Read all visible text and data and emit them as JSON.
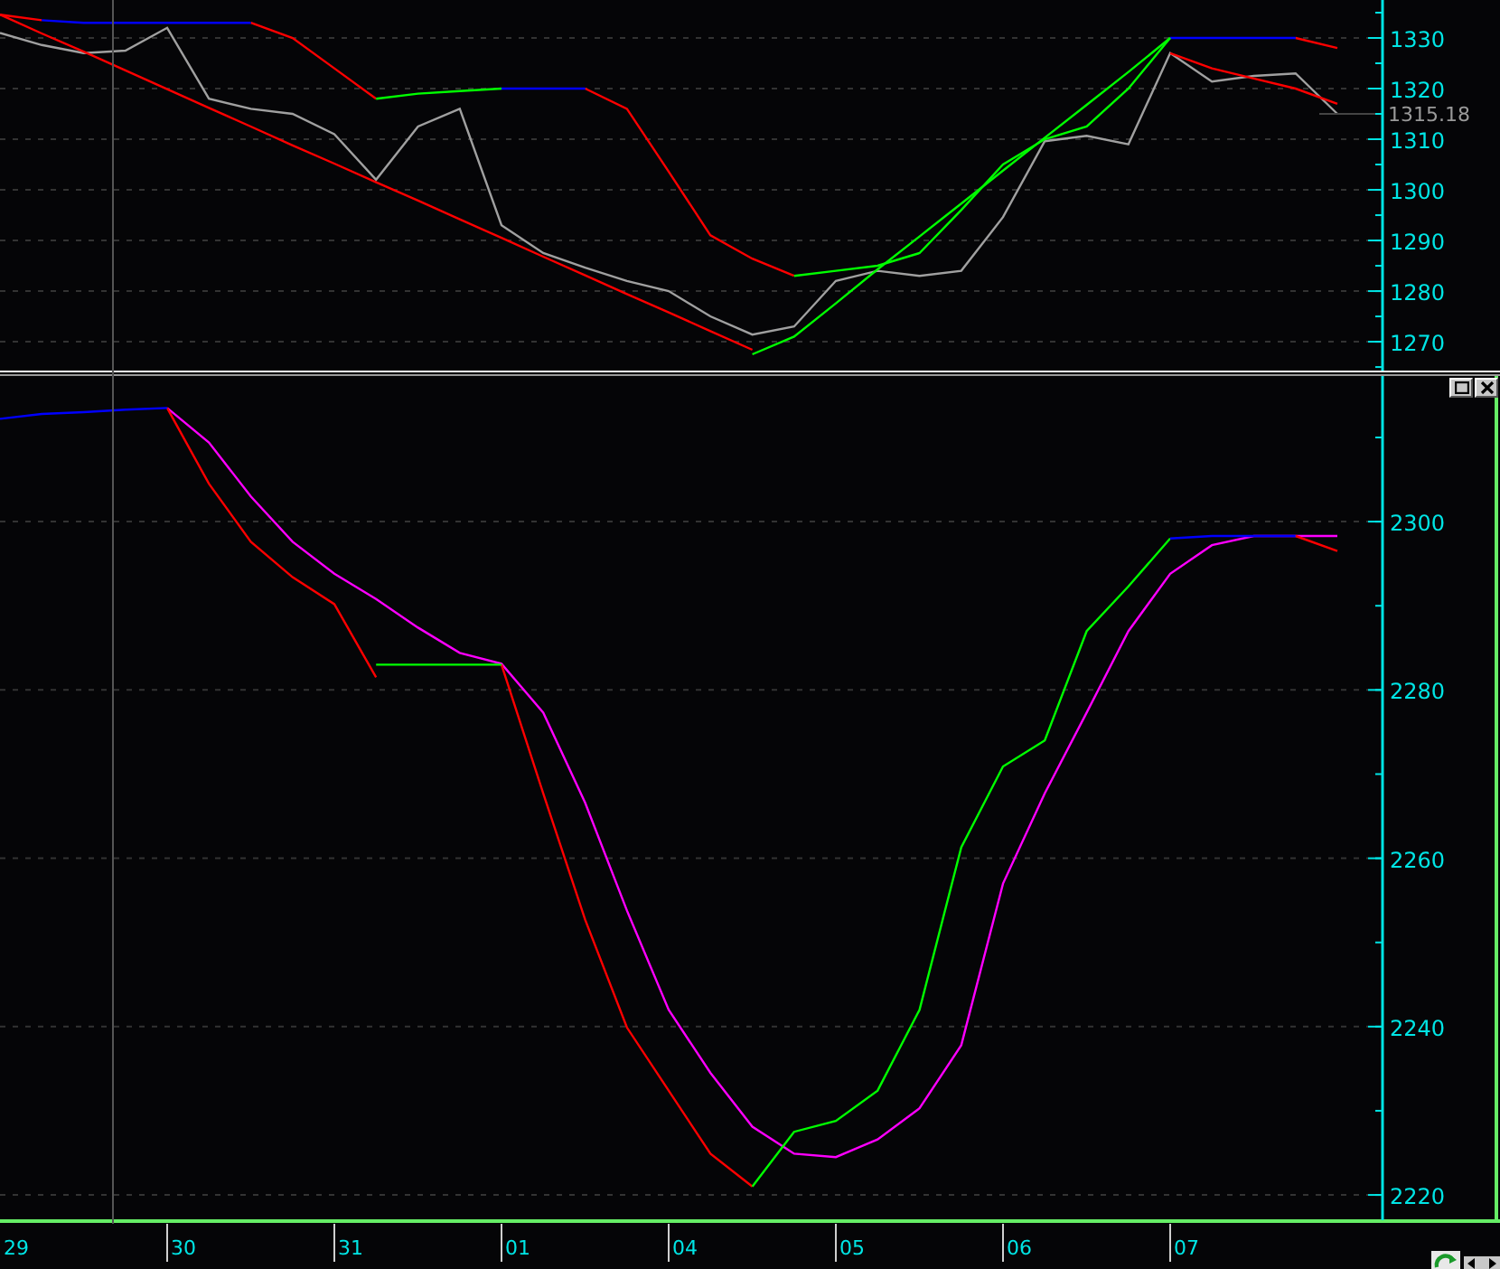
{
  "charts": [
    {
      "chart_data": {
        "type": "line",
        "grid": true,
        "categories": [
          null,
          null,
          null,
          null,
          null,
          null,
          null,
          null,
          null,
          null,
          null,
          null,
          null,
          null,
          null,
          null,
          null,
          null,
          null,
          null,
          null,
          null,
          null,
          null,
          null,
          null,
          null,
          null,
          null,
          null,
          null,
          null,
          null
        ],
        "ylim": [
          1264.3,
          1337.5
        ],
        "yticks": [
          1270,
          1280,
          1290,
          1300,
          1310,
          1320,
          1330
        ],
        "series": [
          {
            "color": "#a0a0a0",
            "values": [
              1331,
              1328.6,
              1327,
              1327.5,
              1332,
              1318,
              1316,
              1315,
              1311,
              1302,
              1312.5,
              1316,
              1293,
              1287.5,
              1284.6,
              1282,
              1280,
              1275,
              1271.4,
              1273,
              1282,
              1284,
              1283,
              1284,
              1294.6,
              1309.6,
              1310.7,
              1309,
              1327,
              1321.4,
              1322.5,
              1323,
              1315
            ]
          },
          {
            "color": "#ff0000",
            "values": [
              1334.6,
              1333.5,
              null,
              null,
              null,
              null,
              1333,
              1330,
              1324,
              1318,
              null,
              null,
              null,
              null,
              1320,
              1316,
              1303.6,
              1291,
              1286.4,
              1283,
              null,
              null,
              null,
              null,
              null,
              null,
              null,
              null,
              null,
              null,
              null,
              1330,
              1328
            ]
          },
          {
            "color": "#0000ff",
            "values": [
              null,
              1333.5,
              1333,
              1333,
              1333,
              1333,
              1333,
              null,
              null,
              null,
              null,
              null,
              1320,
              1320,
              1320,
              null,
              null,
              null,
              null,
              null,
              null,
              null,
              null,
              null,
              null,
              null,
              null,
              null,
              1330,
              1330,
              1330,
              1330,
              null
            ]
          },
          {
            "color": "#00ff00",
            "values": [
              null,
              null,
              null,
              null,
              null,
              null,
              null,
              null,
              null,
              1318,
              1319,
              1319.5,
              1320,
              null,
              null,
              null,
              null,
              null,
              null,
              1283,
              1284,
              1285,
              1287.5,
              1296,
              1305,
              1310,
              1312.5,
              1320,
              1330,
              null,
              null,
              null,
              null
            ]
          },
          {
            "color": "#ff0000",
            "values": [
              1334.6,
              1330.9,
              1327.3,
              1323.6,
              1319.9,
              1316.2,
              1312.5,
              1308.8,
              1305.2,
              1301.5,
              1297.9,
              1294.2,
              1290.5,
              1286.8,
              1283.1,
              1279.4,
              1275.8,
              1272.1,
              1268.4,
              null,
              null,
              null,
              null,
              null,
              null,
              null,
              null,
              null,
              1327,
              1324,
              1322,
              1320,
              1317
            ]
          },
          {
            "color": "#00ff00",
            "values": [
              null,
              null,
              null,
              null,
              null,
              null,
              null,
              null,
              null,
              null,
              null,
              null,
              null,
              null,
              null,
              null,
              null,
              null,
              1267.5,
              1271,
              1277.6,
              1284.3,
              1290.8,
              1297.3,
              1303.8,
              1310.3,
              1316.8,
              1323.3,
              1330,
              null,
              null,
              null,
              null
            ]
          }
        ],
        "annotations": [
          "1315.18"
        ]
      }
    },
    {
      "chart_data": {
        "type": "line",
        "grid": true,
        "categories": [
          "29",
          null,
          null,
          null,
          "30",
          null,
          null,
          null,
          "31",
          null,
          null,
          null,
          "01",
          null,
          null,
          null,
          "04",
          null,
          null,
          null,
          "05",
          null,
          null,
          null,
          "06",
          null,
          null,
          null,
          "07",
          null,
          null,
          null,
          null
        ],
        "ylim": [
          2217,
          2317.3
        ],
        "yticks": [
          2220,
          2240,
          2260,
          2280,
          2300
        ],
        "series": [
          {
            "color": "#ff00ff",
            "values": [
              null,
              null,
              null,
              null,
              2313.5,
              2309.4,
              2303,
              2297.6,
              2293.8,
              2290.8,
              2287.4,
              2284.4,
              2283.1,
              2277.3,
              2266.6,
              2253.8,
              2242,
              2234.5,
              2228.1,
              2224.9,
              2224.5,
              2226.6,
              2230.3,
              2237.8,
              2257,
              2267.7,
              2277.3,
              2287,
              2293.8,
              2297.2,
              2298.3,
              2298.3,
              2298.3
            ]
          },
          {
            "color": "#ff0000",
            "values": [
              null,
              null,
              null,
              null,
              2313.5,
              2304.5,
              2297.6,
              2293.4,
              2290.2,
              2281.5,
              null,
              null,
              2283,
              2267.7,
              2252.7,
              2239.9,
              2232.4,
              2224.9,
              2221,
              null,
              null,
              null,
              null,
              null,
              null,
              null,
              null,
              null,
              null,
              null,
              null,
              2298.3,
              2296.5
            ]
          },
          {
            "color": "#00ff00",
            "values": [
              null,
              null,
              null,
              null,
              null,
              null,
              null,
              null,
              null,
              2283,
              2283,
              2283,
              2283,
              null,
              null,
              null,
              null,
              null,
              2221,
              2227.5,
              2228.8,
              2232.4,
              2242,
              2261.3,
              2270.9,
              2274,
              2287,
              2292.3,
              2298,
              null,
              null,
              null,
              null
            ]
          },
          {
            "color": "#0000ff",
            "values": [
              2312.2,
              2312.8,
              2313,
              2313.3,
              2313.5,
              null,
              null,
              null,
              null,
              null,
              null,
              null,
              null,
              null,
              null,
              null,
              null,
              null,
              null,
              null,
              null,
              null,
              null,
              null,
              null,
              null,
              null,
              null,
              2298,
              2298.3,
              2298.3,
              2298.3,
              null
            ]
          }
        ]
      }
    }
  ]
}
